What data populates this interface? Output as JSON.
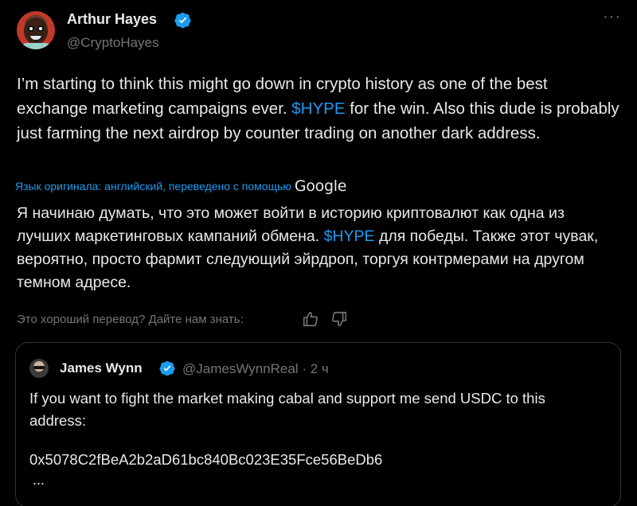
{
  "author": {
    "name": "Arthur Hayes",
    "handle": "@CryptoHayes",
    "verified": true
  },
  "menu": {
    "more_icon": "more-dots-icon"
  },
  "tweet": {
    "text_before": "I’m starting to think this might go down in crypto history as one of the best exchange marketing campaigns ever. ",
    "cashtag": "$HYPE",
    "text_after": " for the win. Also this dude is probably just farming the next airdrop by counter trading on another dark address."
  },
  "translation": {
    "meta_label": "Язык оригинала: английский, переведено с помощью",
    "provider": "Google",
    "text_before": "Я начинаю думать, что это может войти в историю криптовалют как одна из лучших маркетинговых кампаний обмена. ",
    "cashtag": "$HYPE",
    "text_after": " для победы. Также этот чувак, вероятно, просто фармит следующий эйрдроп, торгуя контрмерами на другом темном адресе.",
    "feedback_prompt": "Это хороший перевод? Дайте нам знать:"
  },
  "quote": {
    "name": "James Wynn",
    "verified": true,
    "handle_time": "@JamesWynnReal · 2 ч",
    "text": "If you want to fight the market making cabal and support me send USDC to this address:",
    "address": "0x5078C2fBeA2b2aD61bc840Bc023E35Fce56BeDb6",
    "ellipsis": "..."
  },
  "colors": {
    "background": "#000000",
    "text": "#e7e9ea",
    "muted": "#71767b",
    "accent": "#1d9bf0",
    "border": "#2f3336"
  }
}
